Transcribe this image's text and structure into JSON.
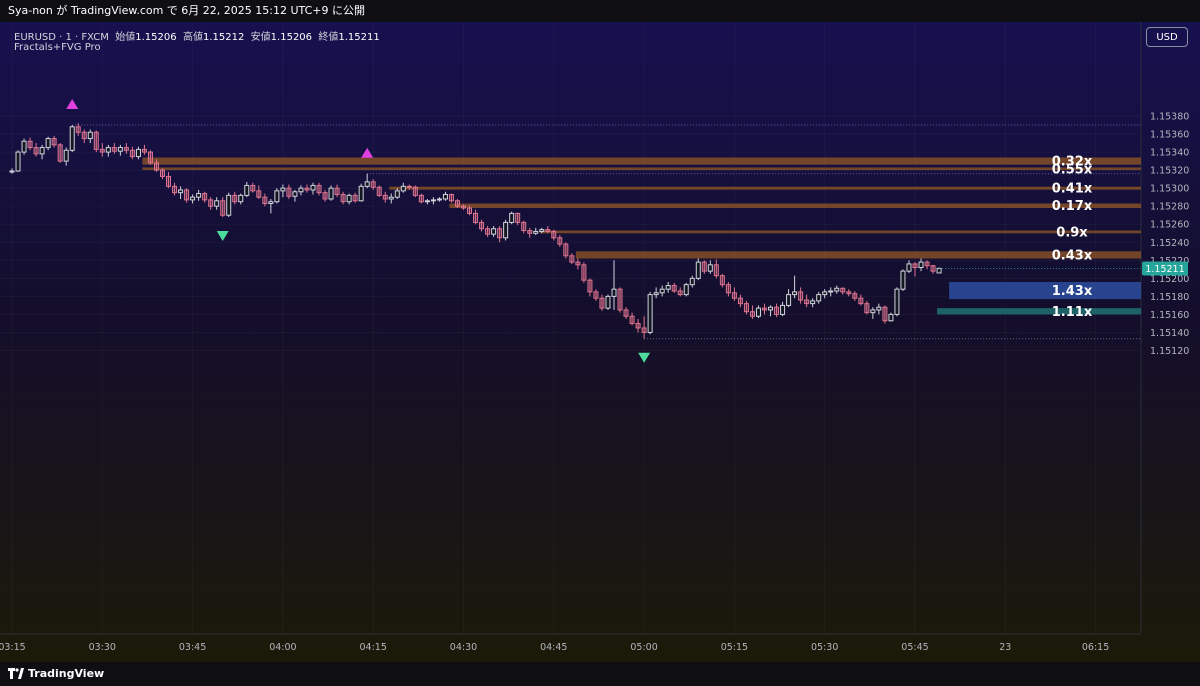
{
  "header": {
    "attribution": "Sya-non が TradingView.com で 6月 22, 2025 15:12 UTC+9 に公開",
    "symbol_line": "EURUSD · 1 · FXCM",
    "ohlc": [
      {
        "label": "始値",
        "value": "1.15206"
      },
      {
        "label": "高値",
        "value": "1.15212"
      },
      {
        "label": "安値",
        "value": "1.15206"
      },
      {
        "label": "終値",
        "value": "1.15211"
      }
    ],
    "indicator": "Fractals+FVG Pro",
    "currency_button": "USD"
  },
  "footer": {
    "brand": "TradingView"
  },
  "colors": {
    "up": "#d1d4dc",
    "down": "#e0748f",
    "bearish_zone": "#8b5326",
    "bullish_zone_blue": "#2a4a9a",
    "bullish_zone_teal": "#1e6b6e",
    "fractal_up": "#e040e0",
    "fractal_down": "#4ddc9c",
    "price_tag": "#26a69a"
  },
  "chart_data": {
    "type": "candlestick",
    "symbol": "EURUSD",
    "interval": "1",
    "yticks": [
      "1.15380",
      "1.15360",
      "1.15340",
      "1.15320",
      "1.15300",
      "1.15280",
      "1.15260",
      "1.15240",
      "1.15220",
      "1.15200",
      "1.15180",
      "1.15160",
      "1.15140",
      "1.15120"
    ],
    "xticks": [
      {
        "label": "03:15",
        "idx": 0
      },
      {
        "label": "03:30",
        "idx": 15
      },
      {
        "label": "03:45",
        "idx": 30
      },
      {
        "label": "04:00",
        "idx": 45
      },
      {
        "label": "04:15",
        "idx": 60
      },
      {
        "label": "04:30",
        "idx": 75
      },
      {
        "label": "04:45",
        "idx": 90
      },
      {
        "label": "05:00",
        "idx": 105
      },
      {
        "label": "05:15",
        "idx": 120
      },
      {
        "label": "05:30",
        "idx": 135
      },
      {
        "label": "05:45",
        "idx": 150
      },
      {
        "label": "23",
        "idx": 165
      },
      {
        "label": "06:15",
        "idx": 180
      }
    ],
    "last_price": "1.15211",
    "candles": [
      [
        1.15318,
        1.15322,
        1.15316,
        1.15319
      ],
      [
        1.15319,
        1.15342,
        1.15318,
        1.1534
      ],
      [
        1.1534,
        1.15355,
        1.15337,
        1.15352
      ],
      [
        1.15352,
        1.15356,
        1.15342,
        1.15345
      ],
      [
        1.15345,
        1.1535,
        1.15335,
        1.15338
      ],
      [
        1.15338,
        1.15348,
        1.15332,
        1.15345
      ],
      [
        1.15345,
        1.15357,
        1.15342,
        1.15355
      ],
      [
        1.15355,
        1.15358,
        1.15345,
        1.15348
      ],
      [
        1.15348,
        1.1535,
        1.15328,
        1.1533
      ],
      [
        1.1533,
        1.15345,
        1.15325,
        1.15342
      ],
      [
        1.15342,
        1.1537,
        1.1534,
        1.15368
      ],
      [
        1.15368,
        1.15372,
        1.15358,
        1.15362
      ],
      [
        1.15362,
        1.15365,
        1.1535,
        1.15355
      ],
      [
        1.15355,
        1.15365,
        1.1535,
        1.15362
      ],
      [
        1.15362,
        1.15364,
        1.1534,
        1.15343
      ],
      [
        1.15343,
        1.1535,
        1.15335,
        1.1534
      ],
      [
        1.1534,
        1.15348,
        1.15335,
        1.15345
      ],
      [
        1.15345,
        1.1535,
        1.15338,
        1.15341
      ],
      [
        1.15341,
        1.15348,
        1.15336,
        1.15345
      ],
      [
        1.15345,
        1.1535,
        1.15338,
        1.15342
      ],
      [
        1.15342,
        1.15346,
        1.15332,
        1.15335
      ],
      [
        1.15335,
        1.15346,
        1.15332,
        1.15343
      ],
      [
        1.15343,
        1.15348,
        1.15337,
        1.1534
      ],
      [
        1.1534,
        1.15342,
        1.15326,
        1.15328
      ],
      [
        1.15328,
        1.15332,
        1.15318,
        1.1532
      ],
      [
        1.1532,
        1.15322,
        1.1531,
        1.15313
      ],
      [
        1.15313,
        1.15318,
        1.153,
        1.15302
      ],
      [
        1.15302,
        1.15306,
        1.15292,
        1.15295
      ],
      [
        1.15295,
        1.15302,
        1.15288,
        1.15298
      ],
      [
        1.15298,
        1.153,
        1.15284,
        1.15287
      ],
      [
        1.15287,
        1.15293,
        1.15283,
        1.1529
      ],
      [
        1.1529,
        1.15298,
        1.15286,
        1.15294
      ],
      [
        1.15294,
        1.15296,
        1.15284,
        1.15287
      ],
      [
        1.15287,
        1.1529,
        1.15276,
        1.1528
      ],
      [
        1.1528,
        1.1529,
        1.15276,
        1.15286
      ],
      [
        1.15286,
        1.1529,
        1.15268,
        1.1527
      ],
      [
        1.1527,
        1.15295,
        1.15268,
        1.15292
      ],
      [
        1.15292,
        1.15296,
        1.15282,
        1.15285
      ],
      [
        1.15285,
        1.15294,
        1.15282,
        1.15292
      ],
      [
        1.15292,
        1.15307,
        1.1529,
        1.15303
      ],
      [
        1.15303,
        1.15306,
        1.15295,
        1.15297
      ],
      [
        1.15297,
        1.15303,
        1.15288,
        1.1529
      ],
      [
        1.1529,
        1.15294,
        1.1528,
        1.15283
      ],
      [
        1.15283,
        1.15288,
        1.15272,
        1.15285
      ],
      [
        1.15285,
        1.153,
        1.15283,
        1.15297
      ],
      [
        1.15297,
        1.15304,
        1.1529,
        1.153
      ],
      [
        1.153,
        1.15304,
        1.15288,
        1.15291
      ],
      [
        1.15291,
        1.15298,
        1.15285,
        1.15296
      ],
      [
        1.15296,
        1.15303,
        1.15292,
        1.153
      ],
      [
        1.153,
        1.15304,
        1.15295,
        1.15298
      ],
      [
        1.15298,
        1.15306,
        1.15293,
        1.15303
      ],
      [
        1.15303,
        1.15306,
        1.15292,
        1.15295
      ],
      [
        1.15295,
        1.15298,
        1.15285,
        1.15288
      ],
      [
        1.15288,
        1.15303,
        1.15286,
        1.153
      ],
      [
        1.153,
        1.15304,
        1.1529,
        1.15293
      ],
      [
        1.15293,
        1.15296,
        1.15282,
        1.15285
      ],
      [
        1.15285,
        1.15294,
        1.15282,
        1.15292
      ],
      [
        1.15292,
        1.15295,
        1.15284,
        1.15286
      ],
      [
        1.15286,
        1.15305,
        1.15285,
        1.15302
      ],
      [
        1.15302,
        1.15316,
        1.153,
        1.15307
      ],
      [
        1.15307,
        1.1531,
        1.15298,
        1.15301
      ],
      [
        1.15301,
        1.15303,
        1.1529,
        1.15292
      ],
      [
        1.15292,
        1.15296,
        1.15284,
        1.15288
      ],
      [
        1.15288,
        1.15294,
        1.15283,
        1.1529
      ],
      [
        1.1529,
        1.153,
        1.15288,
        1.15297
      ],
      [
        1.15297,
        1.15306,
        1.15295,
        1.15302
      ],
      [
        1.15302,
        1.15304,
        1.15298,
        1.15301
      ],
      [
        1.15301,
        1.15303,
        1.1529,
        1.15292
      ],
      [
        1.15292,
        1.15294,
        1.15283,
        1.15285
      ],
      [
        1.15285,
        1.15288,
        1.15282,
        1.15286
      ],
      [
        1.15286,
        1.1529,
        1.15282,
        1.15287
      ],
      [
        1.15287,
        1.1529,
        1.15285,
        1.15288
      ],
      [
        1.15288,
        1.15296,
        1.15286,
        1.15293
      ],
      [
        1.15293,
        1.15294,
        1.15284,
        1.15286
      ],
      [
        1.15286,
        1.15288,
        1.15278,
        1.1528
      ],
      [
        1.1528,
        1.15282,
        1.15276,
        1.15278
      ],
      [
        1.15278,
        1.15281,
        1.1527,
        1.15272
      ],
      [
        1.15272,
        1.15276,
        1.1526,
        1.15262
      ],
      [
        1.15262,
        1.15265,
        1.15252,
        1.15255
      ],
      [
        1.15255,
        1.15258,
        1.15246,
        1.15249
      ],
      [
        1.15249,
        1.15258,
        1.15246,
        1.15255
      ],
      [
        1.15255,
        1.15258,
        1.1524,
        1.15245
      ],
      [
        1.15245,
        1.15265,
        1.15242,
        1.15262
      ],
      [
        1.15262,
        1.15274,
        1.1526,
        1.15272
      ],
      [
        1.15272,
        1.15273,
        1.15259,
        1.15262
      ],
      [
        1.15262,
        1.15264,
        1.1525,
        1.15253
      ],
      [
        1.15253,
        1.15256,
        1.15245,
        1.1525
      ],
      [
        1.1525,
        1.15256,
        1.15248,
        1.15252
      ],
      [
        1.15252,
        1.15256,
        1.1525,
        1.15254
      ],
      [
        1.15254,
        1.15258,
        1.1525,
        1.15252
      ],
      [
        1.15252,
        1.15254,
        1.15242,
        1.15245
      ],
      [
        1.15245,
        1.15248,
        1.15235,
        1.15238
      ],
      [
        1.15238,
        1.1524,
        1.15222,
        1.15225
      ],
      [
        1.15225,
        1.15228,
        1.15216,
        1.15218
      ],
      [
        1.15218,
        1.15222,
        1.1521,
        1.15215
      ],
      [
        1.15215,
        1.15218,
        1.15195,
        1.15198
      ],
      [
        1.15198,
        1.152,
        1.1518,
        1.15185
      ],
      [
        1.15185,
        1.15188,
        1.15175,
        1.15178
      ],
      [
        1.15178,
        1.15182,
        1.15164,
        1.15167
      ],
      [
        1.15167,
        1.15182,
        1.15165,
        1.1518
      ],
      [
        1.1518,
        1.1522,
        1.15165,
        1.15188
      ],
      [
        1.15188,
        1.1519,
        1.15162,
        1.15165
      ],
      [
        1.15165,
        1.15168,
        1.15155,
        1.15158
      ],
      [
        1.15158,
        1.15162,
        1.15148,
        1.1515
      ],
      [
        1.1515,
        1.15155,
        1.1514,
        1.15145
      ],
      [
        1.15145,
        1.15158,
        1.15133,
        1.1514
      ],
      [
        1.1514,
        1.15185,
        1.15138,
        1.15182
      ],
      [
        1.15182,
        1.1519,
        1.15178,
        1.15184
      ],
      [
        1.15184,
        1.15192,
        1.1518,
        1.15188
      ],
      [
        1.15188,
        1.15196,
        1.15184,
        1.15192
      ],
      [
        1.15192,
        1.15195,
        1.15184,
        1.15186
      ],
      [
        1.15186,
        1.1519,
        1.1518,
        1.15182
      ],
      [
        1.15182,
        1.15195,
        1.1518,
        1.15193
      ],
      [
        1.15193,
        1.15203,
        1.1519,
        1.152
      ],
      [
        1.152,
        1.15222,
        1.15198,
        1.15218
      ],
      [
        1.15218,
        1.1522,
        1.15205,
        1.15208
      ],
      [
        1.15208,
        1.1522,
        1.15205,
        1.15215
      ],
      [
        1.15215,
        1.15221,
        1.152,
        1.15203
      ],
      [
        1.15203,
        1.15205,
        1.1519,
        1.15193
      ],
      [
        1.15193,
        1.15196,
        1.1518,
        1.15184
      ],
      [
        1.15184,
        1.1519,
        1.15175,
        1.15178
      ],
      [
        1.15178,
        1.15182,
        1.15168,
        1.15172
      ],
      [
        1.15172,
        1.15175,
        1.1516,
        1.15163
      ],
      [
        1.15163,
        1.1517,
        1.15155,
        1.15158
      ],
      [
        1.15158,
        1.1517,
        1.15156,
        1.15167
      ],
      [
        1.15167,
        1.15172,
        1.1516,
        1.15165
      ],
      [
        1.15165,
        1.1517,
        1.15158,
        1.15168
      ],
      [
        1.15168,
        1.15172,
        1.15157,
        1.1516
      ],
      [
        1.1516,
        1.15174,
        1.15158,
        1.1517
      ],
      [
        1.1517,
        1.15188,
        1.15168,
        1.15182
      ],
      [
        1.15182,
        1.15203,
        1.15178,
        1.15185
      ],
      [
        1.15185,
        1.1519,
        1.15172,
        1.15176
      ],
      [
        1.15176,
        1.15182,
        1.15168,
        1.15172
      ],
      [
        1.15172,
        1.15178,
        1.15168,
        1.15175
      ],
      [
        1.15175,
        1.15185,
        1.15172,
        1.15182
      ],
      [
        1.15182,
        1.15188,
        1.15178,
        1.15185
      ],
      [
        1.15185,
        1.1519,
        1.1518,
        1.15186
      ],
      [
        1.15186,
        1.15192,
        1.15183,
        1.15189
      ],
      [
        1.15189,
        1.1519,
        1.15182,
        1.15185
      ],
      [
        1.15185,
        1.15188,
        1.1518,
        1.15183
      ],
      [
        1.15183,
        1.15186,
        1.15175,
        1.15178
      ],
      [
        1.15178,
        1.15182,
        1.1517,
        1.15172
      ],
      [
        1.15172,
        1.15175,
        1.1516,
        1.15162
      ],
      [
        1.15162,
        1.15168,
        1.15155,
        1.15165
      ],
      [
        1.15165,
        1.15172,
        1.1516,
        1.15168
      ],
      [
        1.15168,
        1.1517,
        1.1515,
        1.15153
      ],
      [
        1.15153,
        1.15162,
        1.15152,
        1.1516
      ],
      [
        1.1516,
        1.1519,
        1.15158,
        1.15188
      ],
      [
        1.15188,
        1.1521,
        1.15186,
        1.15208
      ],
      [
        1.15208,
        1.1522,
        1.15206,
        1.15216
      ],
      [
        1.15216,
        1.15218,
        1.15202,
        1.15212
      ],
      [
        1.15212,
        1.15222,
        1.15208,
        1.15218
      ],
      [
        1.15218,
        1.1522,
        1.1521,
        1.15214
      ],
      [
        1.15214,
        1.15215,
        1.15205,
        1.15208
      ],
      [
        1.15206,
        1.15212,
        1.15206,
        1.15211
      ]
    ],
    "zones": [
      {
        "kind": "bearish",
        "top": 1.15334,
        "bottom": 1.15326,
        "start_idx": 22,
        "label": "0.32x"
      },
      {
        "kind": "bearish",
        "top": 1.15323,
        "bottom": 1.1532,
        "start_idx": 22,
        "label": "0.55x"
      },
      {
        "kind": "bearish",
        "top": 1.15301,
        "bottom": 1.15299,
        "start_idx": 63,
        "label": "0.41x"
      },
      {
        "kind": "bearish",
        "top": 1.15283,
        "bottom": 1.15278,
        "start_idx": 73,
        "label": "0.17x"
      },
      {
        "kind": "bearish",
        "top": 1.15253,
        "bottom": 1.1525,
        "start_idx": 88,
        "label": "0.9x"
      },
      {
        "kind": "bearish",
        "top": 1.1523,
        "bottom": 1.15222,
        "start_idx": 94,
        "label": "0.43x"
      },
      {
        "kind": "bullish",
        "top": 1.15196,
        "bottom": 1.15177,
        "start_idx": 156,
        "label": "1.43x"
      },
      {
        "kind": "bullish",
        "top": 1.15167,
        "bottom": 1.1516,
        "start_idx": 154,
        "label": "1.11x"
      }
    ],
    "fractals": [
      {
        "dir": "up",
        "idx": 10,
        "price": 1.1537
      },
      {
        "dir": "up",
        "idx": 59,
        "price": 1.15316
      },
      {
        "dir": "down",
        "idx": 35,
        "price": 1.15268
      },
      {
        "dir": "down",
        "idx": 105,
        "price": 1.15133
      }
    ],
    "dotted_levels": [
      {
        "price": 1.1537,
        "start_idx": 10
      },
      {
        "price": 1.15316,
        "start_idx": 59
      },
      {
        "price": 1.15133,
        "start_idx": 105
      }
    ]
  }
}
